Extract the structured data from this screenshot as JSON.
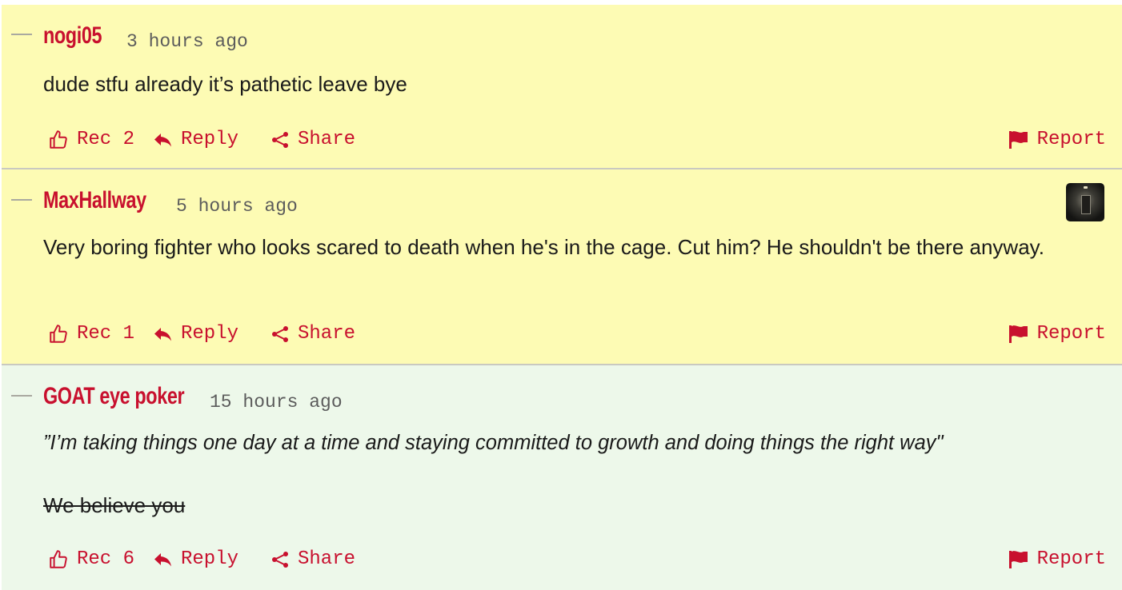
{
  "colors": {
    "accent": "#c8102e",
    "highlight_yellow": "#fdfbb4",
    "highlight_green": "#edf8ea",
    "meta_gray": "#5c5c5c"
  },
  "comments": [
    {
      "username": "nogi05",
      "time": "3 hours ago",
      "lines": [
        "dude stfu already it’s pathetic leave bye"
      ],
      "rec_label": "Rec 2",
      "reply_label": "Reply",
      "share_label": "Share",
      "report_label": "Report",
      "background": "#fdfbb4"
    },
    {
      "username": "MaxHallway",
      "time": "5 hours ago",
      "lines": [
        "Very boring fighter who looks scared to death when he's in the cage. Cut him? He shouldn't be there anyway."
      ],
      "rec_label": "Rec 1",
      "reply_label": "Reply",
      "share_label": "Share",
      "report_label": "Report",
      "background": "#fdfbb4",
      "avatar_icon": "hallway-avatar-icon"
    },
    {
      "username": "GOAT eye poker",
      "time": "15 hours ago",
      "lines": [
        "”I’m taking things one day at a time and staying committed to growth and doing things the right way\"",
        "We believe you"
      ],
      "rec_label": "Rec 6",
      "reply_label": "Reply",
      "share_label": "Share",
      "report_label": "Report",
      "background": "#edf8ea"
    }
  ],
  "icons": {
    "rec": "thumbs-up-icon",
    "reply": "reply-arrow-icon",
    "share": "share-icon",
    "report": "flag-icon",
    "collapse": "collapse-dash-icon"
  }
}
